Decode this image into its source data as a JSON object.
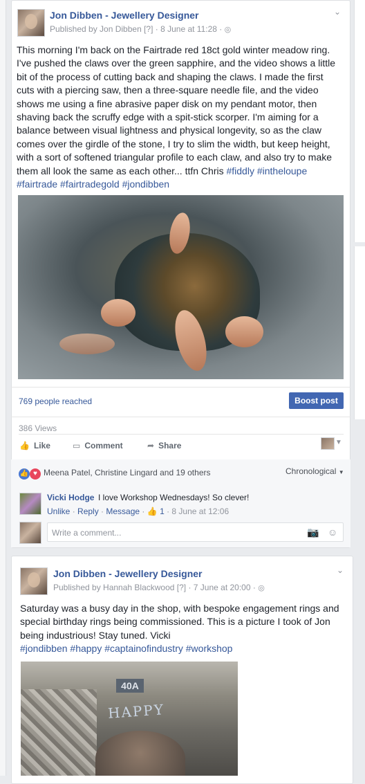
{
  "post1": {
    "author": "Jon Dibben - Jewellery Designer",
    "published_by": "Published by Jon Dibben [?] · 8 June at 11:28 ·",
    "text": "This morning I'm back on the Fairtrade red 18ct gold winter meadow ring. I've pushed the claws over the green sapphire, and the video shows a little bit of the process of cutting back and shaping the claws. I made the first cuts with a piercing saw, then a three-square needle file, and the video shows me using a fine abrasive paper disk on my pendant motor, then shaving back the scruffy edge with a spit-stick scorper. I'm aiming for a balance between visual lightness and physical longevity, so as the claw comes over the girdle of the stone, I try to slim the width, but keep height, with a sort of softened triangular profile to each claw, and also try to make them all look the same as each other... ttfn Chris",
    "hashtags": [
      "#fiddly",
      "#intheloupe",
      "#fairtrade",
      "#fairtradegold",
      "#jondibben"
    ],
    "reach": "769 people reached",
    "boost_label": "Boost post",
    "views": "386 Views",
    "actions": {
      "like": "Like",
      "comment": "Comment",
      "share": "Share"
    },
    "reactions": "Meena Patel, Christine Lingard and 19 others",
    "order_label": "Chronological",
    "comment": {
      "name": "Vicki Hodge",
      "text": "I love Workshop Wednesdays! So clever!",
      "unlike": "Unlike",
      "reply": "Reply",
      "message": "Message",
      "likes": "1",
      "time": "8 June at 12:06"
    },
    "write_placeholder": "Write a comment..."
  },
  "post2": {
    "author": "Jon Dibben - Jewellery Designer",
    "published_by": "Published by Hannah Blackwood [?] · 7 June at 20:00 ·",
    "text": "Saturday was a busy day in the shop, with bespoke engagement rings and special birthday rings being commissioned. This is a picture I took of Jon being industrious! Stay tuned. Vicki",
    "hashtags": [
      "#jondibben",
      "#happy",
      "#captainofindustry",
      "#workshop"
    ],
    "photo_sign": "40A",
    "photo_banner": "HAPPY"
  },
  "icons": [
    "globe-icon",
    "chevron-down-icon",
    "like-icon",
    "comment-icon",
    "share-icon",
    "camera-icon",
    "emoji-icon"
  ],
  "colors": {
    "brand": "#4267b2",
    "link": "#365899",
    "muted": "#90949c",
    "background": "#e9ebee"
  }
}
